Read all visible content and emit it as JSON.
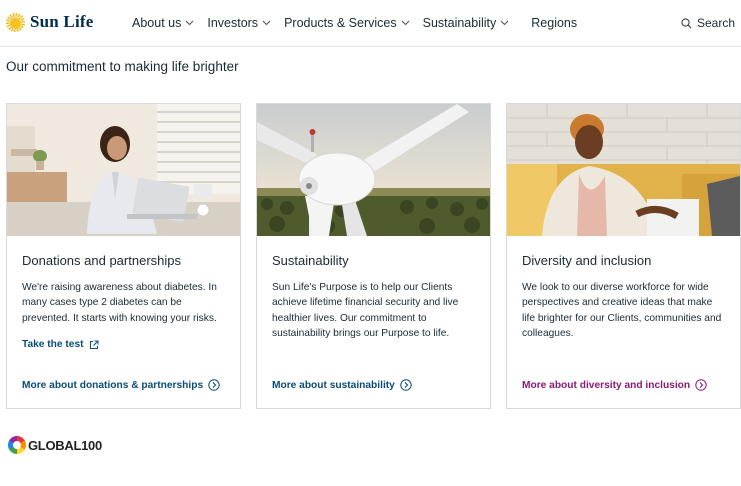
{
  "header": {
    "brand": "Sun Life",
    "nav": [
      {
        "label": "About us"
      },
      {
        "label": "Investors"
      },
      {
        "label": "Products & Services"
      },
      {
        "label": "Sustainability"
      }
    ],
    "regions_label": "Regions",
    "search_label": "Search"
  },
  "intro_heading": "Our commitment to making life brighter",
  "cards": [
    {
      "title": "Donations and partnerships",
      "body": "We're raising awareness about diabetes. In many cases type 2 diabetes can be prevented. It starts with knowing your risks.",
      "inline_link": "Take the test",
      "more_link": "More about donations & partnerships",
      "image": "woman-working-at-laptop"
    },
    {
      "title": "Sustainability",
      "body": "Sun Life's Purpose is to help our Clients achieve lifetime financial security and live healthier lives. Our commitment to sustainability brings our Purpose to life.",
      "more_link": "More about sustainability",
      "image": "wind-turbine-over-forest"
    },
    {
      "title": "Diversity and inclusion",
      "body": "We look to our diverse workforce for wide perspectives and creative ideas that make life brighter for our Clients, communities and colleagues.",
      "more_link": "More about diversity and inclusion",
      "image": "smiling-woman-on-sofa"
    }
  ],
  "global100": {
    "label": "GLOBAL100",
    "mark": "GLOBAL100"
  },
  "colors": {
    "link_blue": "#0a4d78",
    "link_purple": "#8a1b73",
    "brand_navy": "#002d4f",
    "logo_gold": "#f5b400"
  }
}
